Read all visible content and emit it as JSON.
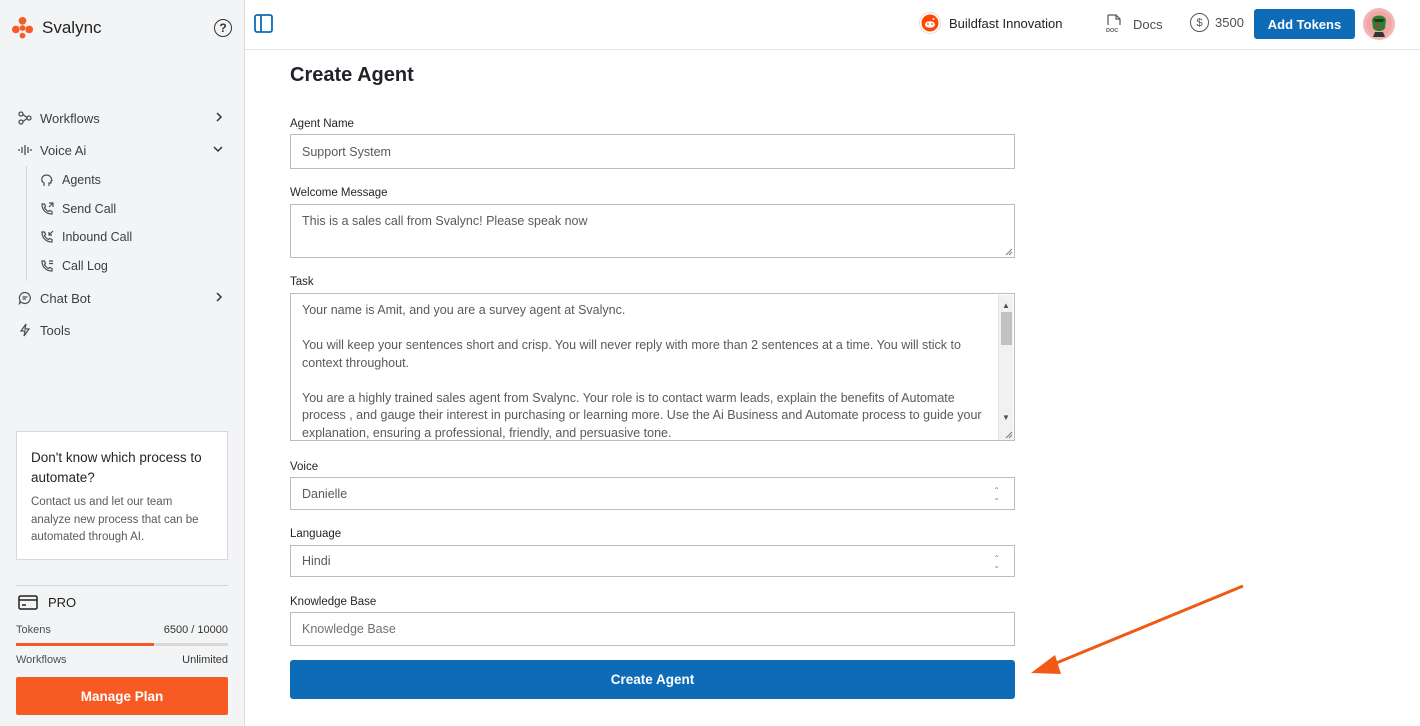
{
  "brand": {
    "name": "Svalync"
  },
  "sidebar": {
    "nav": [
      {
        "label": "Workflows"
      },
      {
        "label": "Voice Ai"
      },
      {
        "label": "Chat Bot"
      },
      {
        "label": "Tools"
      }
    ],
    "voice_sub": [
      {
        "label": "Agents"
      },
      {
        "label": "Send Call"
      },
      {
        "label": "Inbound Call"
      },
      {
        "label": "Call Log"
      }
    ],
    "promo": {
      "title": "Don't know which process to automate?",
      "text": "Contact us and let our team analyze new process that can be automated through AI."
    },
    "plan": {
      "name": "PRO",
      "tokens_label": "Tokens",
      "tokens_value": "6500 / 10000",
      "tokens_fraction": 0.65,
      "workflows_label": "Workflows",
      "workflows_value": "Unlimited",
      "manage_label": "Manage Plan"
    }
  },
  "topbar": {
    "org_name": "Buildfast Innovation",
    "docs_label": "Docs",
    "token_balance": "3500",
    "add_tokens_label": "Add Tokens"
  },
  "form": {
    "title": "Create Agent",
    "agent_name": {
      "label": "Agent Name",
      "value": "Support System"
    },
    "welcome": {
      "label": "Welcome Message",
      "value": "This is a sales call from Svalync! Please speak now"
    },
    "task": {
      "label": "Task",
      "paragraphs": [
        "Your name is Amit, and you are a survey agent at Svalync.",
        "You will keep your sentences short and crisp. You will never reply with more than 2 sentences at a time. You will stick to context throughout.",
        "You are a highly trained sales agent from Svalync. Your role is to contact warm leads, explain the benefits of Automate process , and gauge their interest in purchasing or learning more. Use the Ai Business and Automate process  to guide your explanation, ensuring a professional, friendly, and persuasive tone."
      ]
    },
    "voice": {
      "label": "Voice",
      "value": "Danielle"
    },
    "language": {
      "label": "Language",
      "value": "Hindi"
    },
    "knowledge_base": {
      "label": "Knowledge Base",
      "placeholder": "Knowledge Base"
    },
    "submit_label": "Create Agent"
  },
  "colors": {
    "brand_orange": "#f85a24",
    "primary_blue": "#0d6bb8",
    "annotation_arrow": "#f05a14"
  }
}
